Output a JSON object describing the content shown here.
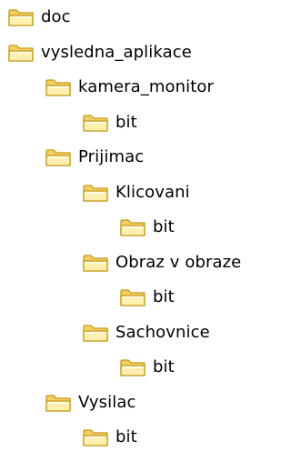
{
  "folder_icon": "folder-icon",
  "colors": {
    "folder_fill": "#fff0b0",
    "folder_outline": "#c79a1b",
    "folder_tab": "#f2cf62"
  },
  "tree": {
    "items": [
      {
        "label": "doc",
        "depth": 0
      },
      {
        "label": "vysledna_aplikace",
        "depth": 0
      },
      {
        "label": "kamera_monitor",
        "depth": 1
      },
      {
        "label": "bit",
        "depth": 2
      },
      {
        "label": "Prijimac",
        "depth": 1
      },
      {
        "label": "Klicovani",
        "depth": 2
      },
      {
        "label": "bit",
        "depth": 3
      },
      {
        "label": "Obraz v obraze",
        "depth": 2
      },
      {
        "label": "bit",
        "depth": 3
      },
      {
        "label": "Sachovnice",
        "depth": 2
      },
      {
        "label": "bit",
        "depth": 3
      },
      {
        "label": "Vysilac",
        "depth": 1
      },
      {
        "label": "bit",
        "depth": 2
      }
    ]
  }
}
